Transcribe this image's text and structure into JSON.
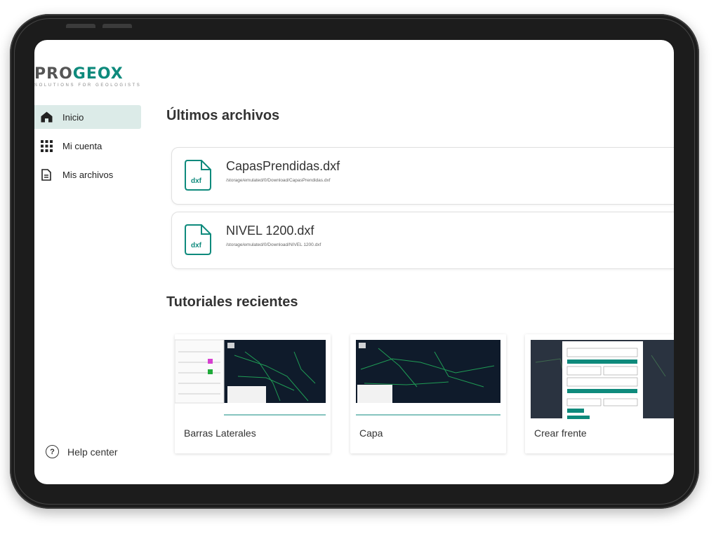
{
  "logo": {
    "name_a": "PRO",
    "name_b": "GEOX",
    "tagline": "SOLUTIONS FOR GEOLOGISTS"
  },
  "sidebar": {
    "items": [
      {
        "label": "Inicio",
        "icon": "home-icon",
        "active": true
      },
      {
        "label": "Mi cuenta",
        "icon": "grid-icon",
        "active": false
      },
      {
        "label": "Mis archivos",
        "icon": "document-icon",
        "active": false
      }
    ],
    "help": {
      "label": "Help center",
      "icon": "question-circle-icon"
    }
  },
  "main": {
    "recent_title": "Últimos archivos",
    "files": [
      {
        "name": "CapasPrendidas.dxf",
        "path": "/storage/emulated/0/Download/CapasPrendidas.dxf",
        "ext": "dxf"
      },
      {
        "name": "NIVEL 1200.dxf",
        "path": "/storage/emulated/0/Download/NIVEL 1200.dxf",
        "ext": "dxf"
      }
    ],
    "tutorials_title": "Tutoriales recientes",
    "tutorials": [
      {
        "title": "Barras Laterales"
      },
      {
        "title": "Capa"
      },
      {
        "title": "Crear frente"
      }
    ]
  },
  "colors": {
    "accent": "#0e8a7c",
    "active_bg": "#dcebe8",
    "map_bg": "#0f1b2b"
  }
}
